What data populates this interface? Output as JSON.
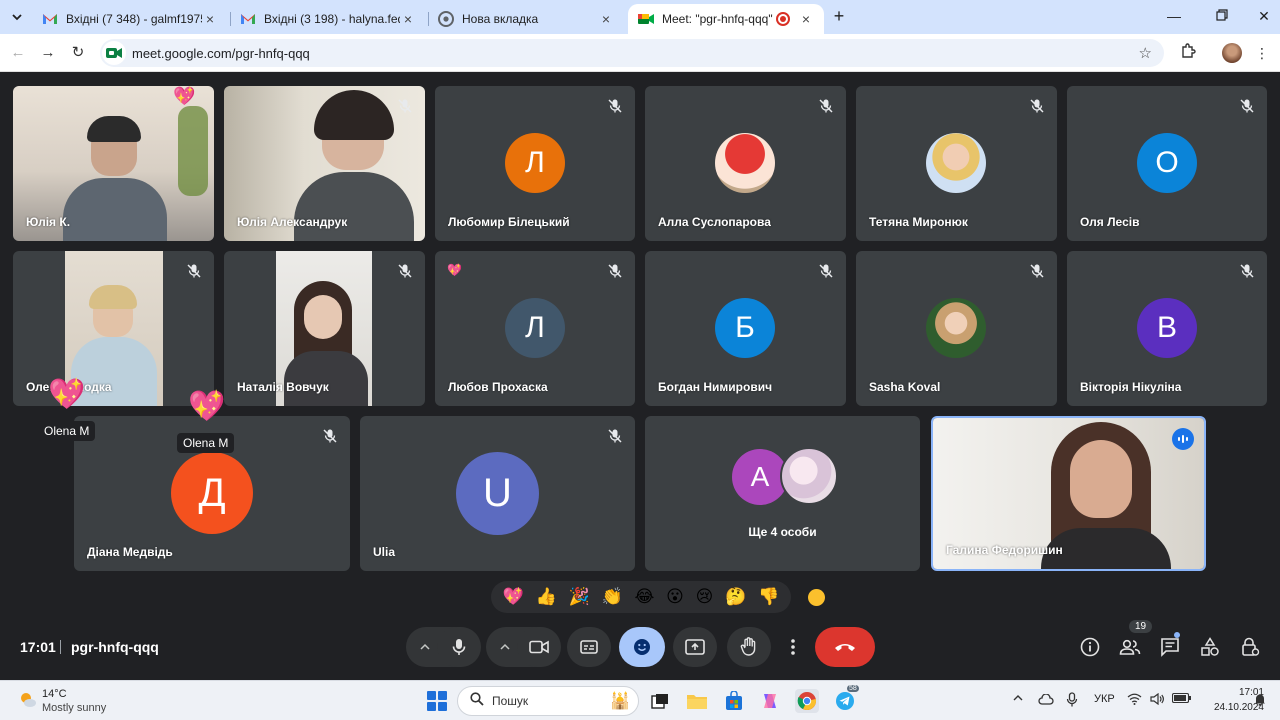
{
  "browser": {
    "tabs": [
      {
        "title": "Вхідні (7 348) - galmf1975@gm",
        "favicon": "gmail-icon"
      },
      {
        "title": "Вхідні (3 198) - halyna.fedorysh",
        "favicon": "gmail-icon"
      },
      {
        "title": "Нова вкладка",
        "favicon": "chrome-icon"
      },
      {
        "title": "Meet: \"pgr-hnfq-qqq\"",
        "favicon": "meet-icon",
        "active": true
      }
    ],
    "url": "meet.google.com/pgr-hnfq-qqq"
  },
  "meeting": {
    "participants": [
      {
        "name": "Юлія К.",
        "type": "video"
      },
      {
        "name": "Юлія Александрук",
        "type": "video",
        "muted": true
      },
      {
        "name": "Любомир Білецький",
        "initial": "Л",
        "color": "#e8710a",
        "muted": true
      },
      {
        "name": "Алла Суслопарова",
        "type": "photo",
        "muted": true
      },
      {
        "name": "Тетяна Миронюк",
        "type": "photo",
        "muted": true
      },
      {
        "name": "Оля Лесів",
        "initial": "О",
        "color": "#0b84d8",
        "muted": true
      },
      {
        "name": "Оле… …лодка",
        "type": "video",
        "muted": true
      },
      {
        "name": "Наталія Вовчук",
        "type": "video",
        "muted": true
      },
      {
        "name": "Любов Прохаска",
        "initial": "Л",
        "color": "#41576b",
        "muted": true
      },
      {
        "name": "Богдан Нимирович",
        "initial": "Б",
        "color": "#0b84d8",
        "muted": true
      },
      {
        "name": "Sasha Koval",
        "type": "photo",
        "muted": true
      },
      {
        "name": "Вікторія Нікуліна",
        "initial": "В",
        "color": "#5b2fbf",
        "muted": true
      },
      {
        "name": "Діана Медвідь",
        "initial": "Д",
        "color": "#f4511e",
        "muted": true
      },
      {
        "name": "Ulia",
        "initial": "U",
        "color": "#5c6bc0",
        "muted": true
      },
      {
        "name": "Галина Федоришин",
        "type": "video",
        "speaking": true
      }
    ],
    "others": {
      "label": "Ще 4 особи",
      "initial": "A",
      "color": "#ab47bc"
    },
    "float_labels": [
      "Olena M",
      "Olena M"
    ],
    "reactions": [
      "💖",
      "👍",
      "🎉",
      "👏",
      "😂",
      "😮",
      "😢",
      "🤔",
      "👎"
    ],
    "clock": "17:01",
    "code": "pgr-hnfq-qqq",
    "participant_count": "19"
  },
  "taskbar": {
    "temp": "14°C",
    "weather": "Mostly sunny",
    "search_placeholder": "Пошук",
    "lang": "УКР",
    "time": "17:01",
    "date": "24.10.2024",
    "telegram_badge": "58"
  }
}
